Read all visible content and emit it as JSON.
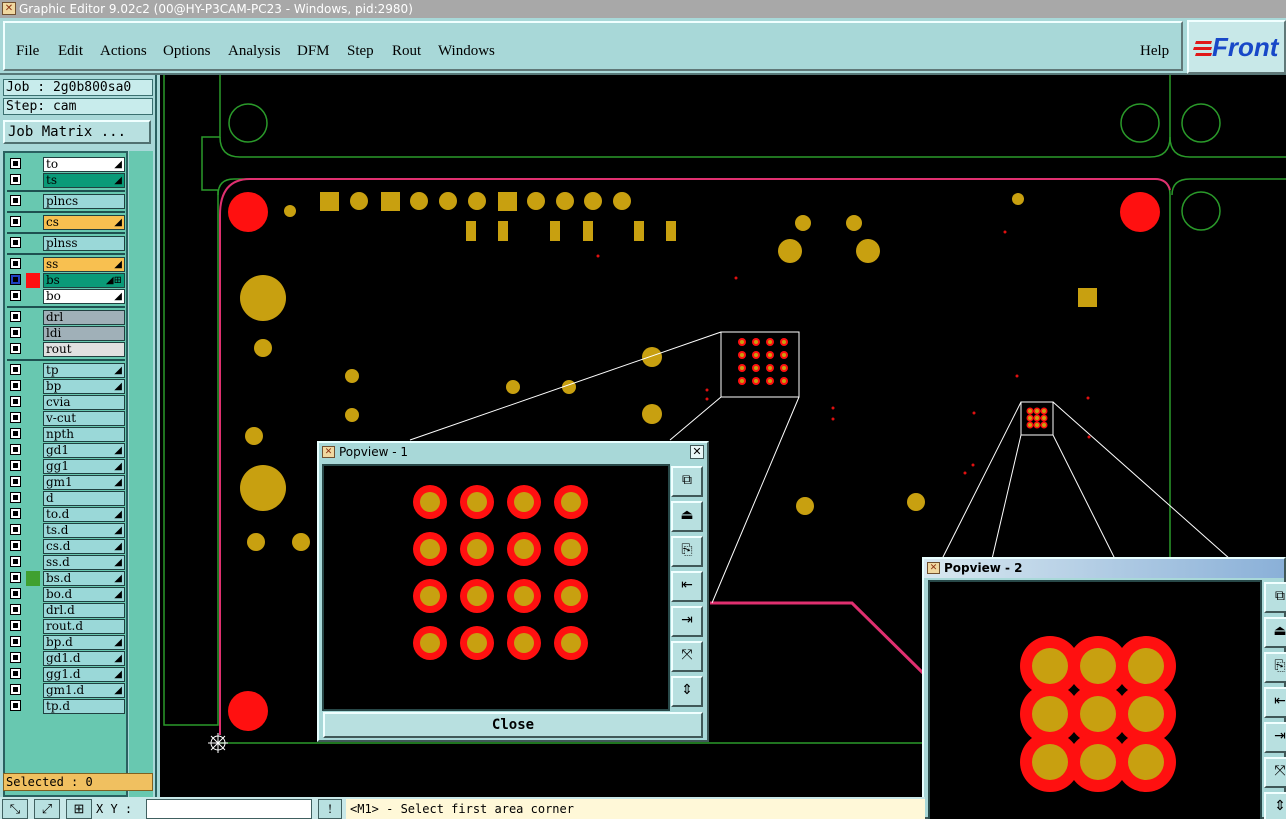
{
  "window": {
    "title": "Graphic Editor 9.02c2 (00@HY-P3CAM-PC23 - Windows, pid:2980)"
  },
  "menu": {
    "items": [
      "File",
      "Edit",
      "Actions",
      "Options",
      "Analysis",
      "DFM",
      "Step",
      "Rout",
      "Windows"
    ],
    "help": "Help"
  },
  "logo": {
    "text": "Front"
  },
  "job": {
    "label": "Job : 2g0b800sa0",
    "step": "Step: cam",
    "matrix_button": "Job Matrix ..."
  },
  "layers": [
    {
      "name": "to",
      "color": "#ffffff",
      "mark": "◢"
    },
    {
      "name": "ts",
      "color": "#0a9a78",
      "mark": "◢"
    },
    {
      "name": "plncs",
      "color": "#9ad8d8",
      "mark": ""
    },
    {
      "name": "cs",
      "color": "#f8c050",
      "mark": "◢"
    },
    {
      "name": "plnss",
      "color": "#9ad8d8",
      "mark": ""
    },
    {
      "name": "ss",
      "color": "#f8c050",
      "mark": "◢"
    },
    {
      "name": "bs",
      "color": "#0a9a78",
      "mark": "◢⊞",
      "active": true
    },
    {
      "name": "bo",
      "color": "#ffffff",
      "mark": "◢"
    },
    {
      "name": "drl",
      "color": "#a0b0b8",
      "mark": ""
    },
    {
      "name": "ldi",
      "color": "#a0b0b8",
      "mark": ""
    },
    {
      "name": "rout",
      "color": "#e0e0e0",
      "mark": ""
    },
    {
      "name": "tp",
      "color": "#9ad8d8",
      "mark": "◢"
    },
    {
      "name": "bp",
      "color": "#9ad8d8",
      "mark": "◢"
    },
    {
      "name": "cvia",
      "color": "#9ad8d8",
      "mark": ""
    },
    {
      "name": "v-cut",
      "color": "#9ad8d8",
      "mark": ""
    },
    {
      "name": "npth",
      "color": "#9ad8d8",
      "mark": ""
    },
    {
      "name": "gd1",
      "color": "#9ad8d8",
      "mark": "◢"
    },
    {
      "name": "gg1",
      "color": "#9ad8d8",
      "mark": "◢"
    },
    {
      "name": "gm1",
      "color": "#9ad8d8",
      "mark": "◢"
    },
    {
      "name": "d",
      "color": "#9ad8d8",
      "mark": ""
    },
    {
      "name": "to.d",
      "color": "#9ad8d8",
      "mark": "◢"
    },
    {
      "name": "ts.d",
      "color": "#9ad8d8",
      "mark": "◢"
    },
    {
      "name": "cs.d",
      "color": "#9ad8d8",
      "mark": "◢"
    },
    {
      "name": "ss.d",
      "color": "#9ad8d8",
      "mark": "◢"
    },
    {
      "name": "bs.d",
      "color": "#9ad8d8",
      "mark": "◢",
      "swatch": "#40a030"
    },
    {
      "name": "bo.d",
      "color": "#9ad8d8",
      "mark": "◢"
    },
    {
      "name": "drl.d",
      "color": "#9ad8d8",
      "mark": ""
    },
    {
      "name": "rout.d",
      "color": "#9ad8d8",
      "mark": ""
    },
    {
      "name": "bp.d",
      "color": "#9ad8d8",
      "mark": "◢"
    },
    {
      "name": "gd1.d",
      "color": "#9ad8d8",
      "mark": "◢"
    },
    {
      "name": "gg1.d",
      "color": "#9ad8d8",
      "mark": "◢"
    },
    {
      "name": "gm1.d",
      "color": "#9ad8d8",
      "mark": "◢"
    },
    {
      "name": "tp.d",
      "color": "#9ad8d8",
      "mark": ""
    }
  ],
  "selected": "Selected : 0",
  "status": {
    "xy_label": "X Y :",
    "xy_value": "",
    "prompt": "<M1> - Select first area corner"
  },
  "popview1": {
    "title": "Popview - 1",
    "close": "Close"
  },
  "popview2": {
    "title": "Popview - 2"
  },
  "colors": {
    "pad": "#c8a010",
    "ring": "#ff1010",
    "outline": "#2a9a2a"
  }
}
